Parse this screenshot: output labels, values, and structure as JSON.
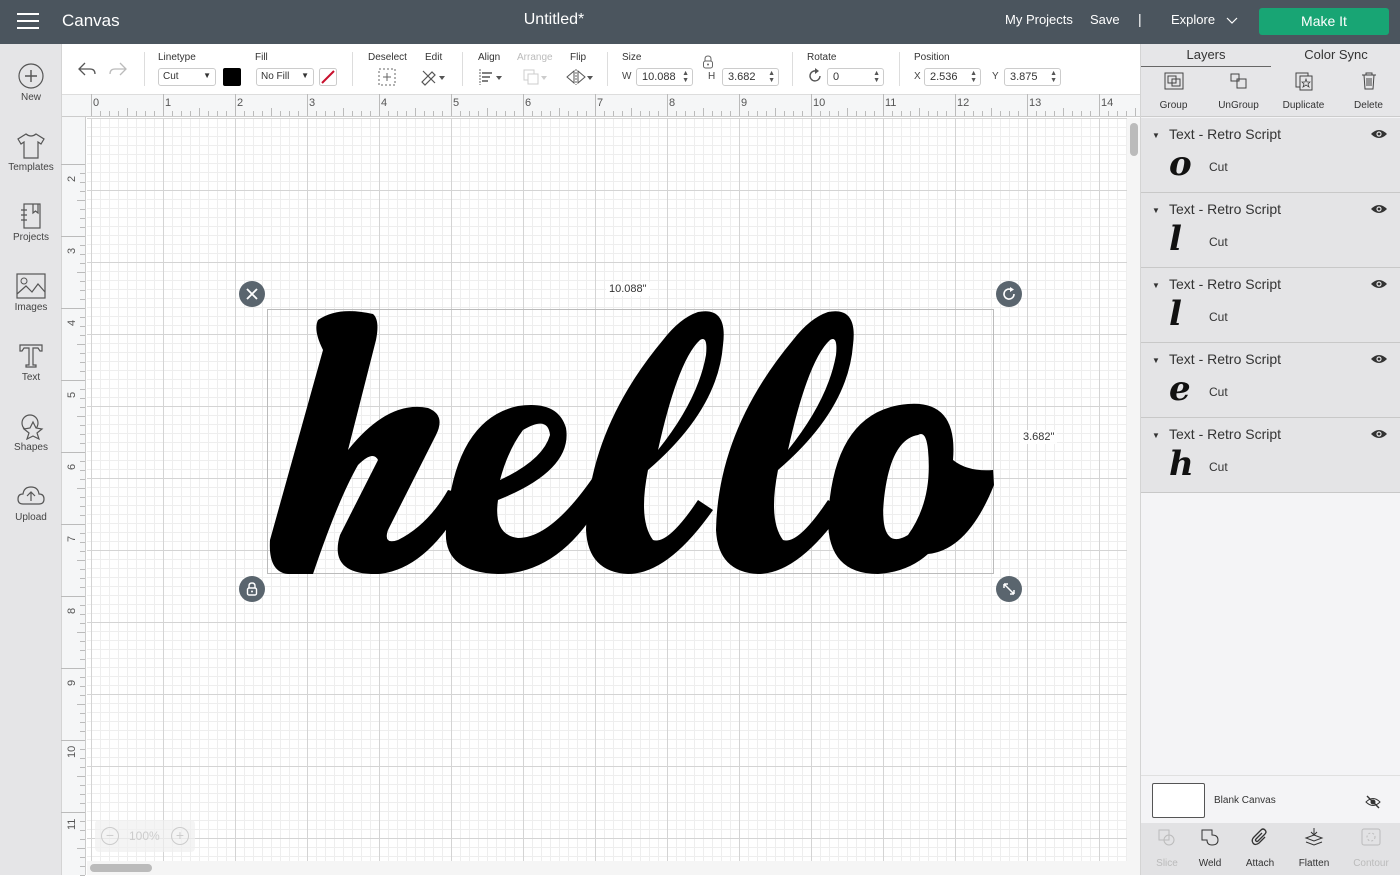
{
  "topbar": {
    "app_title": "Canvas",
    "doc_title": "Untitled*",
    "my_projects": "My Projects",
    "save": "Save",
    "separator": "|",
    "explore": "Explore",
    "make_it": "Make It",
    "accent_color": "#18a574"
  },
  "sidebar": {
    "items": [
      {
        "label": "New",
        "icon": "plus-circle-icon"
      },
      {
        "label": "Templates",
        "icon": "tshirt-icon"
      },
      {
        "label": "Projects",
        "icon": "notebook-icon"
      },
      {
        "label": "Images",
        "icon": "image-icon"
      },
      {
        "label": "Text",
        "icon": "text-icon"
      },
      {
        "label": "Shapes",
        "icon": "shapes-icon"
      },
      {
        "label": "Upload",
        "icon": "cloud-upload-icon"
      }
    ]
  },
  "toolbar": {
    "linetype_label": "Linetype",
    "linetype_value": "Cut",
    "linetype_color": "#000000",
    "fill_label": "Fill",
    "fill_value": "No Fill",
    "deselect_label": "Deselect",
    "edit_label": "Edit",
    "align_label": "Align",
    "arrange_label": "Arrange",
    "flip_label": "Flip",
    "size_label": "Size",
    "w_label": "W",
    "w_value": "10.088",
    "h_label": "H",
    "h_value": "3.682",
    "rotate_label": "Rotate",
    "rotate_value": "0",
    "position_label": "Position",
    "x_label": "X",
    "x_value": "2.536",
    "y_label": "Y",
    "y_value": "3.875"
  },
  "rulers": {
    "horizontal": [
      "0",
      "1",
      "2",
      "3",
      "4",
      "5",
      "6",
      "7",
      "8",
      "9",
      "10",
      "11",
      "12",
      "13",
      "14"
    ],
    "vertical": [
      "2",
      "3",
      "4",
      "5",
      "6",
      "7",
      "8",
      "9",
      "10",
      "11"
    ]
  },
  "canvas": {
    "text": "hello",
    "width_readout": "10.088\"",
    "height_readout": "3.682\"",
    "zoom_level": "100%",
    "zoom_out": "−",
    "zoom_in": "+"
  },
  "rpanel": {
    "tabs": [
      "Layers",
      "Color Sync"
    ],
    "actions": [
      "Group",
      "UnGroup",
      "Duplicate",
      "Delete"
    ],
    "layers": [
      {
        "name": "Text - Retro Script",
        "glyph": "o",
        "type": "Cut"
      },
      {
        "name": "Text - Retro Script",
        "glyph": "l",
        "type": "Cut"
      },
      {
        "name": "Text - Retro Script",
        "glyph": "l",
        "type": "Cut"
      },
      {
        "name": "Text - Retro Script",
        "glyph": "e",
        "type": "Cut"
      },
      {
        "name": "Text - Retro Script",
        "glyph": "h",
        "type": "Cut"
      }
    ],
    "blank_canvas": "Blank Canvas",
    "bottom_actions": [
      {
        "label": "Slice",
        "disabled": true
      },
      {
        "label": "Weld",
        "disabled": false
      },
      {
        "label": "Attach",
        "disabled": false
      },
      {
        "label": "Flatten",
        "disabled": false
      },
      {
        "label": "Contour",
        "disabled": true
      }
    ]
  }
}
